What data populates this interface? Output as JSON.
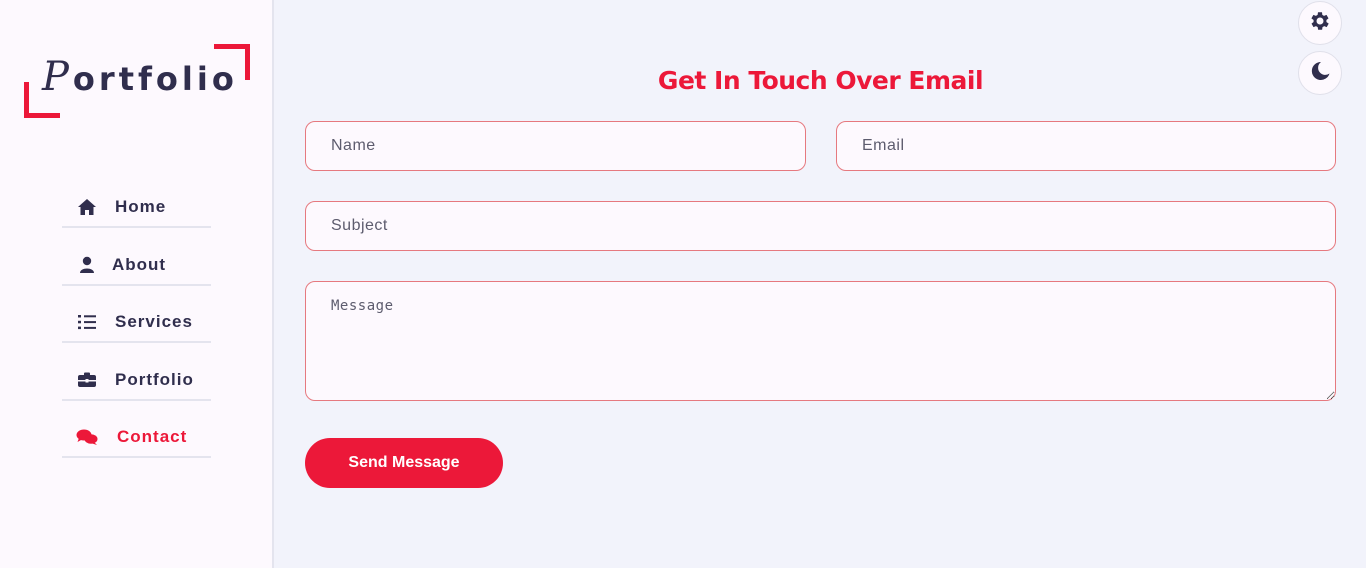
{
  "sidebar": {
    "logo_first": "P",
    "logo_rest": "ortfolio",
    "items": [
      {
        "label": "Home",
        "icon": "home-icon"
      },
      {
        "label": "About",
        "icon": "user-icon"
      },
      {
        "label": "Services",
        "icon": "list-icon"
      },
      {
        "label": "Portfolio",
        "icon": "briefcase-icon"
      },
      {
        "label": "Contact",
        "icon": "comments-icon",
        "active": true
      }
    ]
  },
  "settings": {
    "gear_icon": "gear-icon",
    "theme_icon": "moon-icon"
  },
  "contact": {
    "title": "Get In Touch Over Email",
    "name_placeholder": "Name",
    "email_placeholder": "Email",
    "subject_placeholder": "Subject",
    "message_placeholder": "Message",
    "send_label": "Send Message"
  },
  "colors": {
    "accent": "#ec1839",
    "text": "#302e4d",
    "background": "#f2f3fb",
    "panel": "#fdf9fe"
  }
}
